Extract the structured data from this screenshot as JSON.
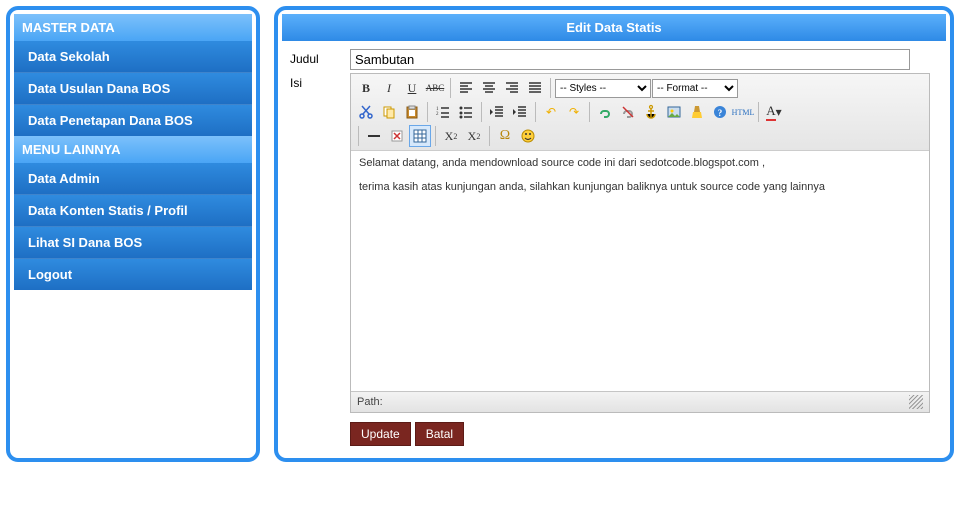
{
  "sidebar": {
    "header_master": "MASTER DATA",
    "master_items": [
      "Data Sekolah",
      "Data Usulan Dana BOS",
      "Data Penetapan Dana BOS"
    ],
    "header_menu": "MENU LAINNYA",
    "menu_items": [
      "Data Admin",
      "Data Konten Statis / Profil",
      "Lihat SI Dana BOS",
      "Logout"
    ]
  },
  "main": {
    "title": "Edit Data Statis",
    "field_judul_label": "Judul",
    "field_isi_label": "Isi",
    "judul_value": "Sambutan",
    "styles_placeholder": "-- Styles --",
    "format_placeholder": "-- Format --",
    "html_btn": "HTML",
    "body_paragraphs": [
      "Selamat datang, anda mendownload source code ini dari sedotcode.blogspot.com ,",
      "terima kasih atas kunjungan anda, silahkan kunjungan baliknya untuk source code yang lainnya"
    ],
    "path_label": "Path:",
    "btn_update": "Update",
    "btn_batal": "Batal"
  }
}
